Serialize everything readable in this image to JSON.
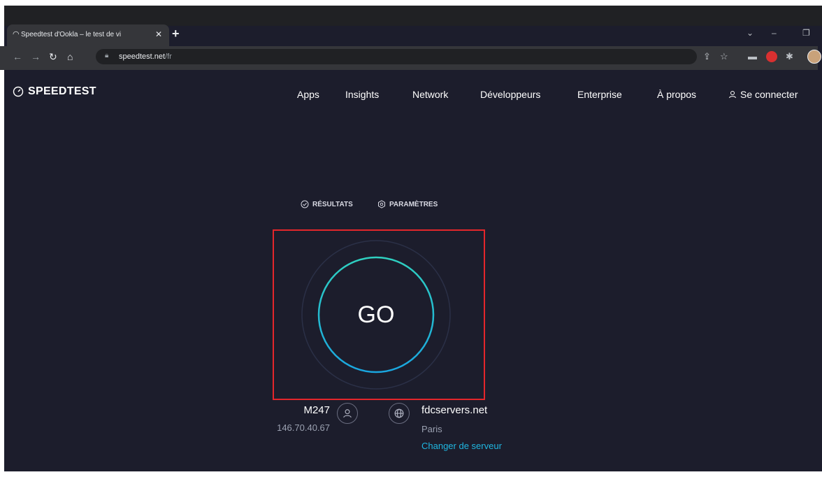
{
  "browser": {
    "tab_title": "Speedtest d'Ookla – le test de vi",
    "url_host": "speedtest.net",
    "url_path": "/fr"
  },
  "site": {
    "logo": "SPEEDTEST",
    "nav": [
      "Apps",
      "Insights",
      "Network",
      "Développeurs",
      "Enterprise",
      "À propos"
    ],
    "login": "Se connecter"
  },
  "subnav": {
    "results": "RÉSULTATS",
    "settings": "PARAMÈTRES"
  },
  "test": {
    "go_label": "GO"
  },
  "isp": {
    "name": "M247",
    "ip": "146.70.40.67"
  },
  "server": {
    "name": "fdcservers.net",
    "city": "Paris",
    "change": "Changer de serveur"
  },
  "colors": {
    "background": "#1c1d2c",
    "accent": "#1fb6e0",
    "highlight": "#e3262b"
  }
}
